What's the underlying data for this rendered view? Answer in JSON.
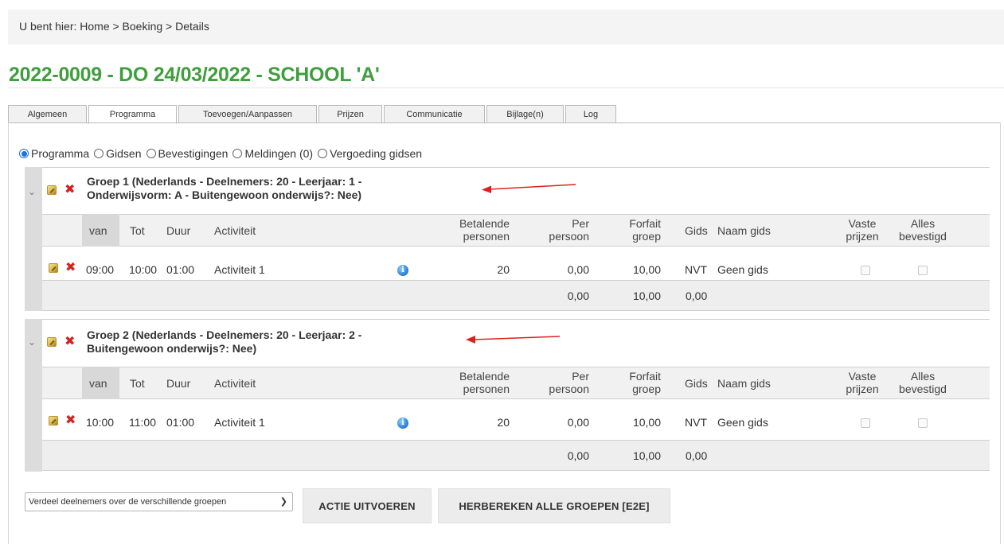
{
  "breadcrumb": {
    "text": "U bent hier: Home > Boeking > Details"
  },
  "page": {
    "title": "2022-0009 - DO 24/03/2022 - SCHOOL 'A'"
  },
  "tabs": [
    {
      "label": "Algemeen",
      "active": false
    },
    {
      "label": "Programma",
      "active": true
    },
    {
      "label": "Toevoegen/Aanpassen",
      "active": false
    },
    {
      "label": "Prijzen",
      "active": false
    },
    {
      "label": "Communicatie",
      "active": false
    },
    {
      "label": "Bijlage(n)",
      "active": false
    },
    {
      "label": "Log",
      "active": false
    }
  ],
  "view_options": [
    {
      "label": "Programma",
      "checked": true
    },
    {
      "label": "Gidsen",
      "checked": false
    },
    {
      "label": "Bevestigingen",
      "checked": false
    },
    {
      "label": "Meldingen (0)",
      "checked": false
    },
    {
      "label": "Vergoeding gidsen",
      "checked": false
    }
  ],
  "columns": {
    "van": "van",
    "tot": "Tot",
    "duur": "Duur",
    "activiteit": "Activiteit",
    "betalende_1": "Betalende",
    "betalende_2": "personen",
    "per_1": "Per",
    "per_2": "persoon",
    "forfait_1": "Forfait",
    "forfait_2": "groep",
    "gids": "Gids",
    "naam_gids": "Naam gids",
    "vaste_1": "Vaste",
    "vaste_2": "prijzen",
    "alles_1": "Alles",
    "alles_2": "bevestigd"
  },
  "groups": [
    {
      "title_line1": "Groep 1 (Nederlands - Deelnemers: 20 - Leerjaar: 1 -",
      "title_line2": "Onderwijsvorm: A - Buitengewoon onderwijs?: Nee)",
      "row": {
        "van": "09:00",
        "tot": "10:00",
        "duur": "01:00",
        "activiteit": "Activiteit 1",
        "betalende": "20",
        "per_persoon": "0,00",
        "forfait": "10,00",
        "gids": "NVT",
        "naam_gids": "Geen gids"
      },
      "totals": {
        "per_persoon": "0,00",
        "forfait": "10,00",
        "gids": "0,00"
      }
    },
    {
      "title_line1": "Groep 2 (Nederlands - Deelnemers: 20 - Leerjaar: 2 -",
      "title_line2": "Buitengewoon onderwijs?: Nee)",
      "row": {
        "van": "10:00",
        "tot": "11:00",
        "duur": "01:00",
        "activiteit": "Activiteit 1",
        "betalende": "20",
        "per_persoon": "0,00",
        "forfait": "10,00",
        "gids": "NVT",
        "naam_gids": "Geen gids"
      },
      "totals": {
        "per_persoon": "0,00",
        "forfait": "10,00",
        "gids": "0,00"
      }
    }
  ],
  "actions": {
    "select_value": "Verdeel deelnemers over de verschillende groepen",
    "run_label": "ACTIE UITVOEREN",
    "recalc_label": "HERBEREKEN ALLE GROEPEN [E2E]"
  },
  "colors": {
    "title": "#3f9e3d",
    "arrow": "#e02020",
    "delete": "#d62121"
  }
}
